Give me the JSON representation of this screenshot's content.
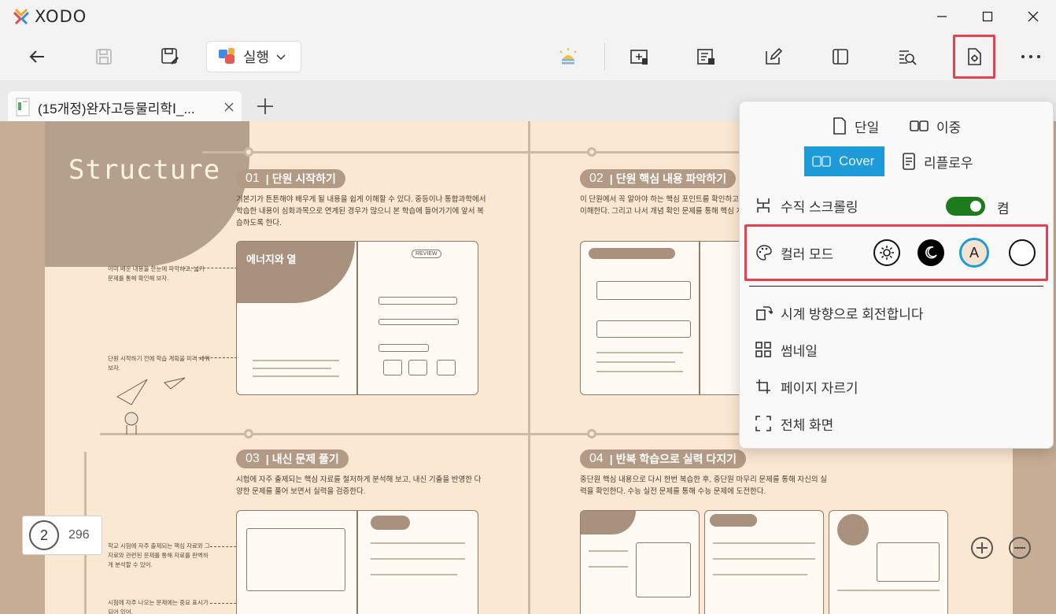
{
  "app": {
    "name": "XODO"
  },
  "toolbar": {
    "run_label": "실행"
  },
  "tab": {
    "title": "(15개정)완자고등물리학Ⅰ_..."
  },
  "document": {
    "title": "Structure",
    "sections": [
      {
        "num": "01",
        "title": "단원 시작하기",
        "body": "기본기가 튼튼해야 배우게 될 내용을 쉽게 이해할 수 있다. 중등이나 통합과학에서 학습한 내용이 심화과목으로 연계된 경우가 많으니 본 학습에 들어가기에 앞서 복습하도록 한다."
      },
      {
        "num": "02",
        "title": "단원 핵심 내용 파악하기",
        "body": "이 단원에서 꼭 알아야 하는 핵심 포인트를 확인하고, 친절한 설명을 통해 개념을 이해한다. 그리고 나서 개념 확인 문제를 통해 핵심 개념을 확인한다."
      },
      {
        "num": "03",
        "title": "내신 문제 풀기",
        "body": "시험에 자주 출제되는 핵심 자료를 철저하게 분석해 보고, 내신 기출을 반영한 다양한 문제를 풀어 보면서 실력을 검증한다."
      },
      {
        "num": "04",
        "title": "반복 학습으로 실력 다지기",
        "body": "중단원 핵심 내용으로 다시 한번 복습한 후, 중단원 마무리 문제를 통해 자신의 실력을 확인한다. 수능 실전 문제를 통해 수능 문제에 도전한다."
      }
    ],
    "notes": [
      "이미 배운 내용을 한눈에 파악하고, 넓기 문제를 통해 확인해 보자.",
      "단원 시작하기 전에 학습 계획을 미리 세워 보자.",
      "학교 시험에 자주 출제되는 핵심 자료와 그 자료와 관련된 문제를 통해 자료를 완벽하게 분석할 수 있어.",
      "시험에 자주 나오는 문제에는 중요 표시가 되어 있어."
    ],
    "thumb_labels": {
      "s1_heading": "에너지와 열",
      "s1_badge": "REVIEW"
    }
  },
  "page_nav": {
    "current": "2",
    "total": "296"
  },
  "menu": {
    "single": "단일",
    "double": "이중",
    "cover": "Cover",
    "reflow": "리플로우",
    "vertical_scroll": "수직 스크롤링",
    "toggle_state": "켬",
    "vertical_scroll_on": true,
    "color_mode": "컬러 모드",
    "color_mode_auto": "A",
    "rotate": "시계 방향으로 회전합니다",
    "thumbnails": "썸네일",
    "crop": "페이지 자르기",
    "fullscreen": "전체 화면"
  },
  "colors": {
    "accent": "#1d9bd8",
    "toggle_on": "#1d7a1d",
    "highlight_box": "#e8404e",
    "page_bg": "#fbe8d2",
    "section_head": "#b39a84"
  }
}
